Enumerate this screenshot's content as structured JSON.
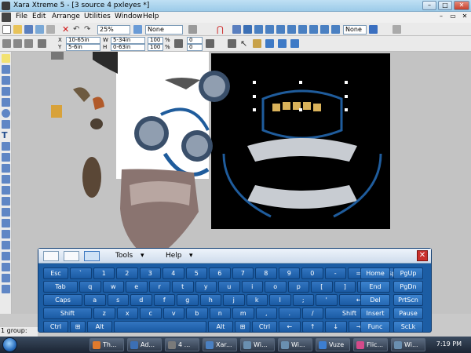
{
  "window": {
    "title": "Xara Xtreme 5 - [3 source 4 pxleyes *]"
  },
  "menu": [
    "File",
    "Edit",
    "Arrange",
    "Utilities",
    "Window",
    "Help"
  ],
  "toolbar1": {
    "zoom": "25%",
    "quality": "None",
    "quality2": "None",
    "spin1": "0",
    "spin2": "0"
  },
  "toolbar2": {
    "x": "X",
    "y": "Y",
    "xval": "10-65in",
    "yval": "5-6in",
    "w": "W",
    "h": "H",
    "wval": "5-34in",
    "hval": "0-63in",
    "pct1": "100",
    "pct2": "100",
    "pct_sym": "%",
    "angle": "0",
    "degree": "0"
  },
  "status": {
    "text": "1 group:"
  },
  "osk": {
    "menus": [
      "Tools",
      "Help"
    ],
    "rows": [
      [
        "Esc",
        "`",
        "1",
        "2",
        "3",
        "4",
        "5",
        "6",
        "7",
        "8",
        "9",
        "0",
        "-",
        "=",
        "Bksp",
        "Home",
        "PgUp"
      ],
      [
        "Tab",
        "q",
        "w",
        "e",
        "r",
        "t",
        "y",
        "u",
        "i",
        "o",
        "p",
        "[",
        "]",
        "\\",
        "End",
        "PgDn"
      ],
      [
        "Caps",
        "a",
        "s",
        "d",
        "f",
        "g",
        "h",
        "j",
        "k",
        "l",
        ";",
        "'",
        "⟵",
        "Del",
        "PrtScn"
      ],
      [
        "Shift",
        "z",
        "x",
        "c",
        "v",
        "b",
        "n",
        "m",
        ",",
        ".",
        "/",
        "Shift",
        "Insert",
        "Pause"
      ],
      [
        "Ctrl",
        "⊞",
        "Alt",
        "",
        "Alt",
        "⊞",
        "Ctrl",
        "←",
        "↑",
        "↓",
        "→",
        "Func",
        "ScLk"
      ]
    ]
  },
  "taskbar": {
    "buttons": [
      "Th...",
      "Ad...",
      "4 ...",
      "Xar...",
      "Wi...",
      "Wi...",
      "Vuze",
      "Flic...",
      "Wi..."
    ],
    "clock": "7:19 PM"
  },
  "colors": {
    "accent": "#1c5da4",
    "canvas_black": "#000000"
  }
}
